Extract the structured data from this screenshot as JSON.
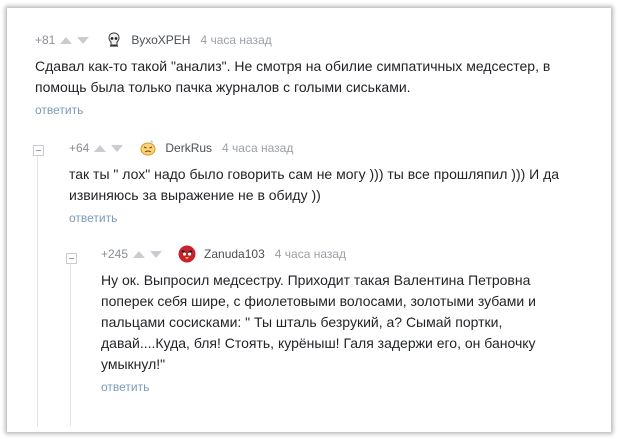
{
  "comments": [
    {
      "rating": "+81",
      "author": "ВухоХРЕН",
      "time": "4 часа назад",
      "avatar": "skull-icon",
      "lines": [
        "Сдавал как-то такой \"анализ\". Не смотря на обилие симпатичных медсестер, в",
        "помощь была только пачка журналов с голыми сиськами."
      ],
      "reply": "ответить"
    },
    {
      "rating": "+64",
      "author": "DerkRus",
      "time": "4 часа назад",
      "avatar": "emoticon-avatar",
      "lines": [
        "так ты \" лох\" надо было говорить сам не могу ))) ты все прошляпил ))) И да",
        "извиняюсь за выражение не в обиду ))"
      ],
      "reply": "ответить"
    },
    {
      "rating": "+245",
      "author": "Zanuda103",
      "time": "4 часа назад",
      "avatar": "angry-bird-avatar",
      "lines": [
        "Ну ок. Выпросил медсестру. Приходит такая Валентина Петровна",
        "поперек себя шире, с фиолетовыми волосами, золотыми зубами и",
        "пальцами сосисками: \" Ты шталь безрукий, а? Сымай портки,",
        "давай....Куда, бля! Стоять, курёныш! Галя задержи его, он баночку",
        "умыкнул!\""
      ],
      "reply": "ответить"
    }
  ]
}
